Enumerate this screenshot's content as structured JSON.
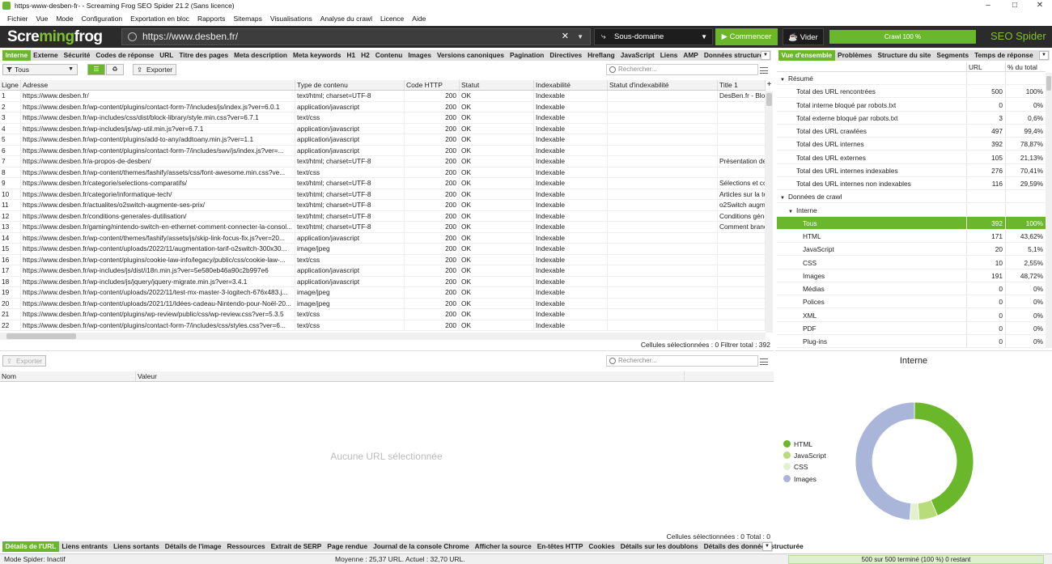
{
  "window": {
    "title": "https-www-desben-fr- - Screaming Frog SEO Spider 21.2 (Sans licence)"
  },
  "menu": [
    "Fichier",
    "Vue",
    "Mode",
    "Configuration",
    "Exportation en bloc",
    "Rapports",
    "Sitemaps",
    "Visualisations",
    "Analyse du crawl",
    "Licence",
    "Aide"
  ],
  "topbar": {
    "logo_pre": "Scre",
    "logo_mid": "ming",
    "logo_post": "frog",
    "url": "https://www.desben.fr/",
    "mode": "Sous-domaine",
    "start": "Commencer",
    "clear": "Vider",
    "progress": "Crawl 100 %",
    "progress_value": 1.0,
    "product": "SEO Spider",
    "accent": "#6ab72b"
  },
  "main_tabs": [
    "Interne",
    "Externe",
    "Sécurité",
    "Codes de réponse",
    "URL",
    "Titre des pages",
    "Meta description",
    "Meta keywords",
    "H1",
    "H2",
    "Contenu",
    "Images",
    "Versions canoniques",
    "Pagination",
    "Directives",
    "Hreflang",
    "JavaScript",
    "Liens",
    "AMP",
    "Données structurées",
    "Si"
  ],
  "main_toolbar": {
    "filter": "Tous",
    "export": "Exporter",
    "search_placeholder": "Rechercher..."
  },
  "main_table": {
    "headers": [
      "Ligne",
      "Adresse",
      "Type de contenu",
      "Code HTTP",
      "Statut",
      "Indexabilité",
      "Statut d'indexabilité",
      "Title 1"
    ],
    "rows": [
      [
        "1",
        "https://www.desben.fr/",
        "text/html; charset=UTF-8",
        "200",
        "OK",
        "Indexable",
        "",
        "DesBen.fr - Blog"
      ],
      [
        "2",
        "https://www.desben.fr/wp-content/plugins/contact-form-7/includes/js/index.js?ver=6.0.1",
        "application/javascript",
        "200",
        "OK",
        "Indexable",
        "",
        ""
      ],
      [
        "3",
        "https://www.desben.fr/wp-includes/css/dist/block-library/style.min.css?ver=6.7.1",
        "text/css",
        "200",
        "OK",
        "Indexable",
        "",
        ""
      ],
      [
        "4",
        "https://www.desben.fr/wp-includes/js/wp-util.min.js?ver=6.7.1",
        "application/javascript",
        "200",
        "OK",
        "Indexable",
        "",
        ""
      ],
      [
        "5",
        "https://www.desben.fr/wp-content/plugins/add-to-any/addtoany.min.js?ver=1.1",
        "application/javascript",
        "200",
        "OK",
        "Indexable",
        "",
        ""
      ],
      [
        "6",
        "https://www.desben.fr/wp-content/plugins/contact-form-7/includes/swv/js/index.js?ver=...",
        "application/javascript",
        "200",
        "OK",
        "Indexable",
        "",
        ""
      ],
      [
        "7",
        "https://www.desben.fr/a-propos-de-desben/",
        "text/html; charset=UTF-8",
        "200",
        "OK",
        "Indexable",
        "",
        "Présentation de"
      ],
      [
        "8",
        "https://www.desben.fr/wp-content/themes/fashify/assets/css/font-awesome.min.css?ve...",
        "text/css",
        "200",
        "OK",
        "Indexable",
        "",
        ""
      ],
      [
        "9",
        "https://www.desben.fr/categorie/selections-comparatifs/",
        "text/html; charset=UTF-8",
        "200",
        "OK",
        "Indexable",
        "",
        "Sélections et cc"
      ],
      [
        "10",
        "https://www.desben.fr/categorie/informatique-tech/",
        "text/html; charset=UTF-8",
        "200",
        "OK",
        "Indexable",
        "",
        "Articles sur la te"
      ],
      [
        "11",
        "https://www.desben.fr/actualites/o2switch-augmente-ses-prix/",
        "text/html; charset=UTF-8",
        "200",
        "OK",
        "Indexable",
        "",
        "o2Switch augm"
      ],
      [
        "12",
        "https://www.desben.fr/conditions-generales-dutilisation/",
        "text/html; charset=UTF-8",
        "200",
        "OK",
        "Indexable",
        "",
        "Conditions géné"
      ],
      [
        "13",
        "https://www.desben.fr/gaming/nintendo-switch-en-ethernet-comment-connecter-la-consol...",
        "text/html; charset=UTF-8",
        "200",
        "OK",
        "Indexable",
        "",
        "Comment branc"
      ],
      [
        "14",
        "https://www.desben.fr/wp-content/themes/fashify/assets/js/skip-link-focus-fix.js?ver=20...",
        "application/javascript",
        "200",
        "OK",
        "Indexable",
        "",
        ""
      ],
      [
        "15",
        "https://www.desben.fr/wp-content/uploads/2022/11/augmentation-tarif-o2switch-300x30...",
        "image/jpeg",
        "200",
        "OK",
        "Indexable",
        "",
        ""
      ],
      [
        "16",
        "https://www.desben.fr/wp-content/plugins/cookie-law-info/legacy/public/css/cookie-law-...",
        "text/css",
        "200",
        "OK",
        "Indexable",
        "",
        ""
      ],
      [
        "17",
        "https://www.desben.fr/wp-includes/js/dist/i18n.min.js?ver=5e580eb46a90c2b997e6",
        "application/javascript",
        "200",
        "OK",
        "Indexable",
        "",
        ""
      ],
      [
        "18",
        "https://www.desben.fr/wp-includes/js/jquery/jquery-migrate.min.js?ver=3.4.1",
        "application/javascript",
        "200",
        "OK",
        "Indexable",
        "",
        ""
      ],
      [
        "19",
        "https://www.desben.fr/wp-content/uploads/2022/11/test-mx-master-3-logitech-676x483.j...",
        "image/jpeg",
        "200",
        "OK",
        "Indexable",
        "",
        ""
      ],
      [
        "20",
        "https://www.desben.fr/wp-content/uploads/2021/11/Idées-cadeau-Nintendo-pour-Noël-20...",
        "image/jpeg",
        "200",
        "OK",
        "Indexable",
        "",
        ""
      ],
      [
        "21",
        "https://www.desben.fr/wp-content/plugins/wp-review/public/css/wp-review.css?ver=5.3.5",
        "text/css",
        "200",
        "OK",
        "Indexable",
        "",
        ""
      ],
      [
        "22",
        "https://www.desben.fr/wp-content/plugins/contact-form-7/includes/css/styles.css?ver=6...",
        "text/css",
        "200",
        "OK",
        "Indexable",
        "",
        ""
      ]
    ],
    "status_text": "Cellules sélectionnées : 0  Filtrer total : 392"
  },
  "detail": {
    "export": "Exporter",
    "search_placeholder": "Rechercher...",
    "headers": [
      "Nom",
      "Valeur"
    ],
    "empty": "Aucune URL sélectionnée",
    "status_text": "Cellules sélectionnées : 0  Total : 0"
  },
  "bottom_tabs": [
    "Détails de l'URL",
    "Liens entrants",
    "Liens sortants",
    "Détails de l'image",
    "Ressources",
    "Extrait de SERP",
    "Page rendue",
    "Journal de la console Chrome",
    "Afficher la source",
    "En-têtes HTTP",
    "Cookies",
    "Détails sur les doublons",
    "Détails des données structurée"
  ],
  "right_tabs": [
    "Vue d'ensemble",
    "Problèmes",
    "Structure du site",
    "Segments",
    "Temps de réponse",
    "AF"
  ],
  "summary": {
    "headers": [
      "URL",
      "% du total"
    ],
    "rows": [
      {
        "label": "Résumé",
        "url": "",
        "pct": "",
        "level": 0,
        "section": true
      },
      {
        "label": "Total des URL rencontrées",
        "url": "500",
        "pct": "100%",
        "level": 1
      },
      {
        "label": "Total interne bloqué par robots.txt",
        "url": "0",
        "pct": "0%",
        "level": 1
      },
      {
        "label": "Total externe bloqué par robots.txt",
        "url": "3",
        "pct": "0,6%",
        "level": 1
      },
      {
        "label": "Total des URL crawlées",
        "url": "497",
        "pct": "99,4%",
        "level": 1
      },
      {
        "label": "Total des URL internes",
        "url": "392",
        "pct": "78,87%",
        "level": 1
      },
      {
        "label": "Total des URL externes",
        "url": "105",
        "pct": "21,13%",
        "level": 1
      },
      {
        "label": "Total des URL internes indexables",
        "url": "276",
        "pct": "70,41%",
        "level": 1
      },
      {
        "label": "Total des URL internes non indexables",
        "url": "116",
        "pct": "29,59%",
        "level": 1
      },
      {
        "label": "Données de crawl",
        "url": "",
        "pct": "",
        "level": 0,
        "section": true
      },
      {
        "label": "Interne",
        "url": "",
        "pct": "",
        "level": 1,
        "section": true
      },
      {
        "label": "Tous",
        "url": "392",
        "pct": "100%",
        "level": 2,
        "highlight": true
      },
      {
        "label": "HTML",
        "url": "171",
        "pct": "43,62%",
        "level": 2
      },
      {
        "label": "JavaScript",
        "url": "20",
        "pct": "5,1%",
        "level": 2
      },
      {
        "label": "CSS",
        "url": "10",
        "pct": "2,55%",
        "level": 2
      },
      {
        "label": "Images",
        "url": "191",
        "pct": "48,72%",
        "level": 2
      },
      {
        "label": "Médias",
        "url": "0",
        "pct": "0%",
        "level": 2
      },
      {
        "label": "Polices",
        "url": "0",
        "pct": "0%",
        "level": 2
      },
      {
        "label": "XML",
        "url": "0",
        "pct": "0%",
        "level": 2
      },
      {
        "label": "PDF",
        "url": "0",
        "pct": "0%",
        "level": 2
      },
      {
        "label": "Plug-ins",
        "url": "0",
        "pct": "0%",
        "level": 2
      }
    ]
  },
  "chart": {
    "title": "Interne",
    "legend": [
      {
        "name": "HTML",
        "color": "#6ab72b"
      },
      {
        "name": "JavaScript",
        "color": "#b8dc7a"
      },
      {
        "name": "CSS",
        "color": "#e2f1cf"
      },
      {
        "name": "Images",
        "color": "#a9b5d9"
      }
    ]
  },
  "chart_data": {
    "type": "pie",
    "title": "Interne",
    "categories": [
      "HTML",
      "JavaScript",
      "CSS",
      "Images"
    ],
    "values": [
      171,
      20,
      10,
      191
    ],
    "legend_position": "left"
  },
  "footer": {
    "mode": "Mode Spider: Inactif",
    "average": "Moyenne : 25,37 URL. Actuel : 32,70 URL.",
    "progress": "500 sur 500 terminé (100 %) 0 restant"
  }
}
